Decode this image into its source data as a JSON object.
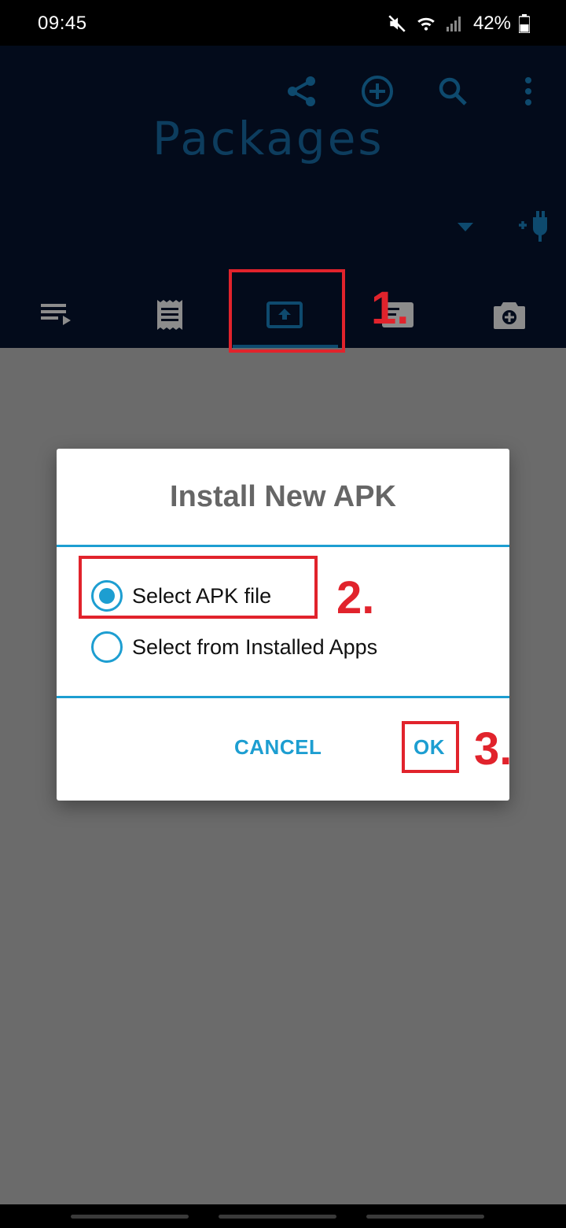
{
  "status_bar": {
    "time": "09:45",
    "battery": "42%",
    "icons": [
      "mute-icon",
      "wifi-icon",
      "signal-icon",
      "battery-icon"
    ]
  },
  "header": {
    "title": "Packages",
    "actions": [
      "share-icon",
      "add-circle-icon",
      "search-icon",
      "more-vert-icon"
    ]
  },
  "tabs": [
    {
      "name": "queue-icon"
    },
    {
      "name": "receipt-icon"
    },
    {
      "name": "install-apk-icon",
      "selected": true
    },
    {
      "name": "list-card-icon"
    },
    {
      "name": "camera-icon"
    }
  ],
  "annotations": {
    "step1": "1.",
    "step2": "2.",
    "step3": "3."
  },
  "dialog": {
    "title": "Install New APK",
    "options": [
      {
        "label": "Select APK file",
        "checked": true
      },
      {
        "label": "Select from Installed Apps",
        "checked": false
      }
    ],
    "cancel_label": "CANCEL",
    "ok_label": "OK"
  },
  "colors": {
    "accent": "#1d9ed1",
    "annotation": "#e1232c",
    "header_bg": "#030b1b",
    "scrim": "#6b6b6b"
  }
}
